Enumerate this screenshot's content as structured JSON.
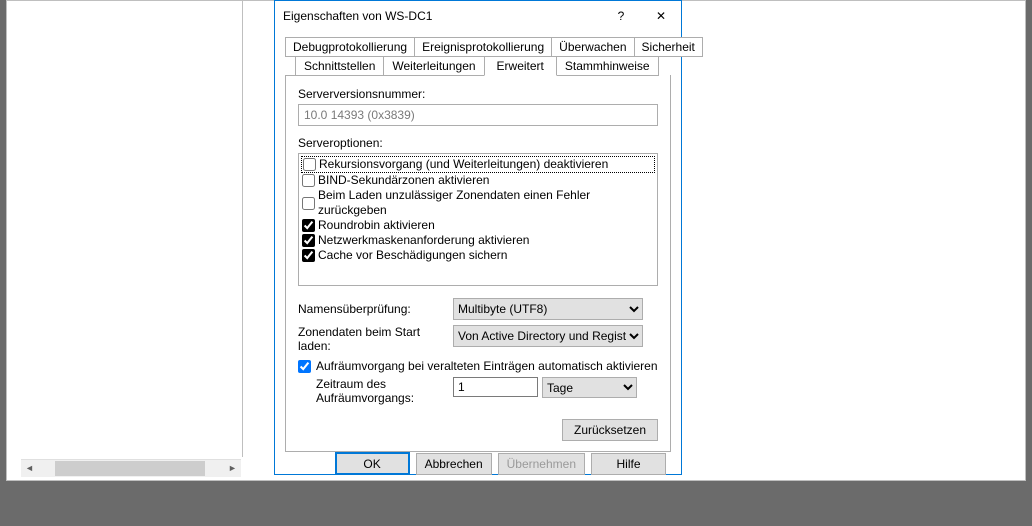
{
  "dialog": {
    "title": "Eigenschaften von WS-DC1",
    "help_symbol": "?",
    "close_symbol": "✕"
  },
  "tabs": {
    "row1": [
      "Debugprotokollierung",
      "Ereignisprotokollierung",
      "Überwachen",
      "Sicherheit"
    ],
    "row2": [
      "Schnittstellen",
      "Weiterleitungen",
      "Erweitert",
      "Stammhinweise"
    ],
    "active": "Erweitert"
  },
  "advanced": {
    "version_label": "Serverversionsnummer:",
    "version_value": "10.0 14393 (0x3839)",
    "options_label": "Serveroptionen:",
    "options": [
      {
        "label": "Rekursionsvorgang (und Weiterleitungen) deaktivieren",
        "checked": false
      },
      {
        "label": "BIND-Sekundärzonen aktivieren",
        "checked": false
      },
      {
        "label": "Beim Laden unzulässiger Zonendaten einen Fehler zurückgeben",
        "checked": false
      },
      {
        "label": "Roundrobin aktivieren",
        "checked": true
      },
      {
        "label": "Netzwerkmaskenanforderung aktivieren",
        "checked": true
      },
      {
        "label": "Cache vor Beschädigungen sichern",
        "checked": true
      }
    ],
    "name_check_label": "Namensüberprüfung:",
    "name_check_value": "Multibyte (UTF8)",
    "zone_load_label": "Zonendaten beim Start laden:",
    "zone_load_value": "Von Active Directory und Registrierung",
    "scavenge_checkbox": "Aufräumvorgang bei veralteten Einträgen automatisch aktivieren",
    "scavenge_checked": true,
    "scavenge_period_label": "Zeitraum des Aufräumvorgangs:",
    "scavenge_period_value": "1",
    "scavenge_period_unit": "Tage",
    "reset_label": "Zurücksetzen"
  },
  "buttons": {
    "ok": "OK",
    "cancel": "Abbrechen",
    "apply": "Übernehmen",
    "help": "Hilfe"
  },
  "scrollbar": {
    "left": "◄",
    "right": "►"
  }
}
